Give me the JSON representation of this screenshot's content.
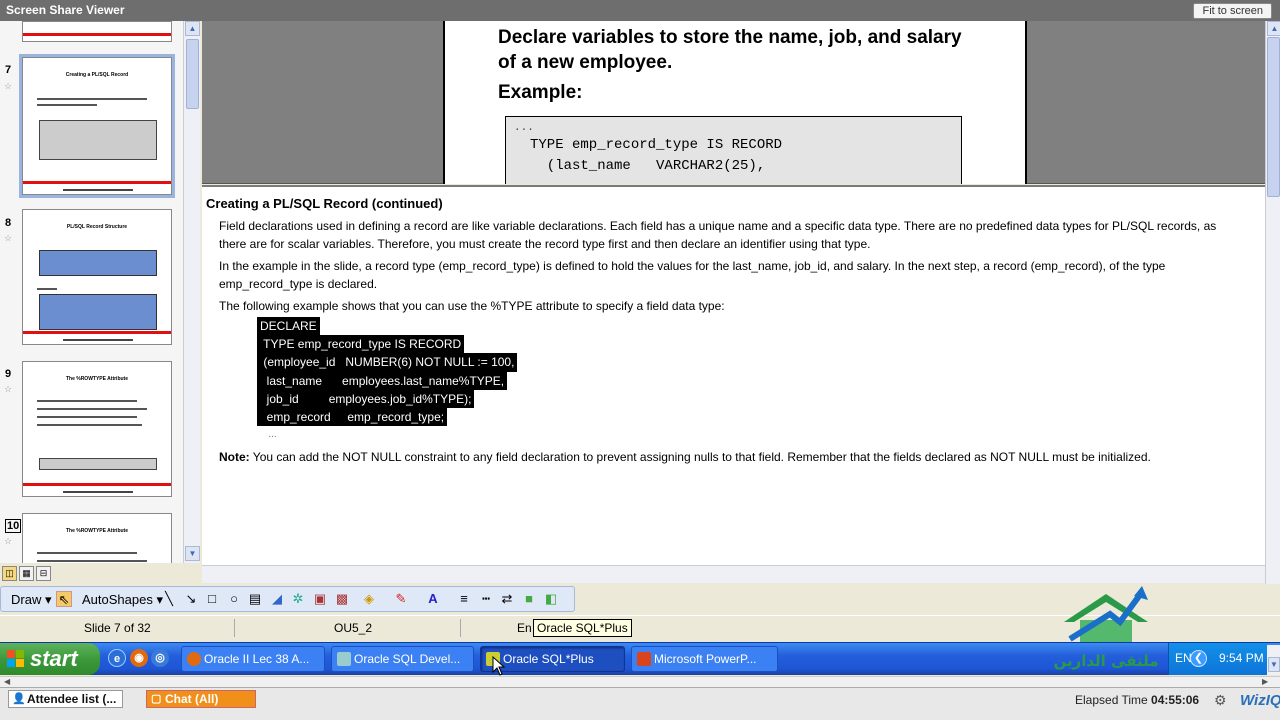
{
  "window": {
    "title": "Screen Share Viewer",
    "fit_button": "Fit to screen"
  },
  "sorter": {
    "slides": [
      {
        "num": "7",
        "title": "Creating a PL/SQL Record"
      },
      {
        "num": "8",
        "title": "PL/SQL Record Structure"
      },
      {
        "num": "9",
        "title": "The %ROWTYPE Attribute"
      },
      {
        "num": "10",
        "title": "The %ROWTYPE Attribute"
      }
    ]
  },
  "slide": {
    "heading": "Declare variables to store the name, job, and salary of a new employee.",
    "example_label": "Example:",
    "code": [
      "...",
      "TYPE emp_record_type IS RECORD",
      "  (last_name   VARCHAR2(25),"
    ]
  },
  "notes": {
    "title": "Creating a PL/SQL Record (continued)",
    "p1": "Field declarations used in defining a record are like variable declarations. Each field has a unique name and a specific data type. There are no predefined data types for PL/SQL records, as there are for scalar variables. Therefore, you must create the record type first and then declare an identifier using that type.",
    "p2": "In the example in the slide, a record type (emp_record_type) is defined to hold the values for the last_name, job_id, and salary. In the next step, a record (emp_record), of the type emp_record_type is declared.",
    "p3": "The following example shows that you can use the %TYPE attribute to specify a field data type:",
    "code": [
      "DECLARE",
      " TYPE emp_record_type IS RECORD",
      " (employee_id   NUMBER(6) NOT NULL := 100,",
      "  last_name      employees.last_name%TYPE,",
      "  job_id         employees.job_id%TYPE);",
      "  emp_record     emp_record_type;",
      "   ..."
    ],
    "note_label": "Note:",
    "note_text": " You can add the NOT NULL constraint to any field declaration to prevent assigning nulls to that field. Remember that the fields declared as NOT NULL must be initialized."
  },
  "drawbar": {
    "draw": "Draw",
    "autoshapes": "AutoShapes"
  },
  "status": {
    "slide": "Slide 7 of 32",
    "design": "OU5_2",
    "lang_partial": "En",
    "tooltip": "Oracle SQL*Plus"
  },
  "taskbar": {
    "start": "start",
    "tasks": [
      "Oracle II Lec 38 A...",
      "Oracle SQL Devel...",
      "Oracle SQL*Plus",
      "Microsoft PowerP..."
    ],
    "lang": "EN",
    "clock": "9:54 PM"
  },
  "bottom": {
    "attendee": "Attendee list (...",
    "chat": "Chat (All)",
    "elapsed_label": "Elapsed Time",
    "elapsed_value": "04:55:06",
    "brand": "WizIQ"
  },
  "logo_text": "ملتقى الدارين",
  "colors": {
    "taskbar": "#245edb",
    "start": "#3c9a3a",
    "chat": "#f0901a",
    "slide_red": "#e01010"
  }
}
